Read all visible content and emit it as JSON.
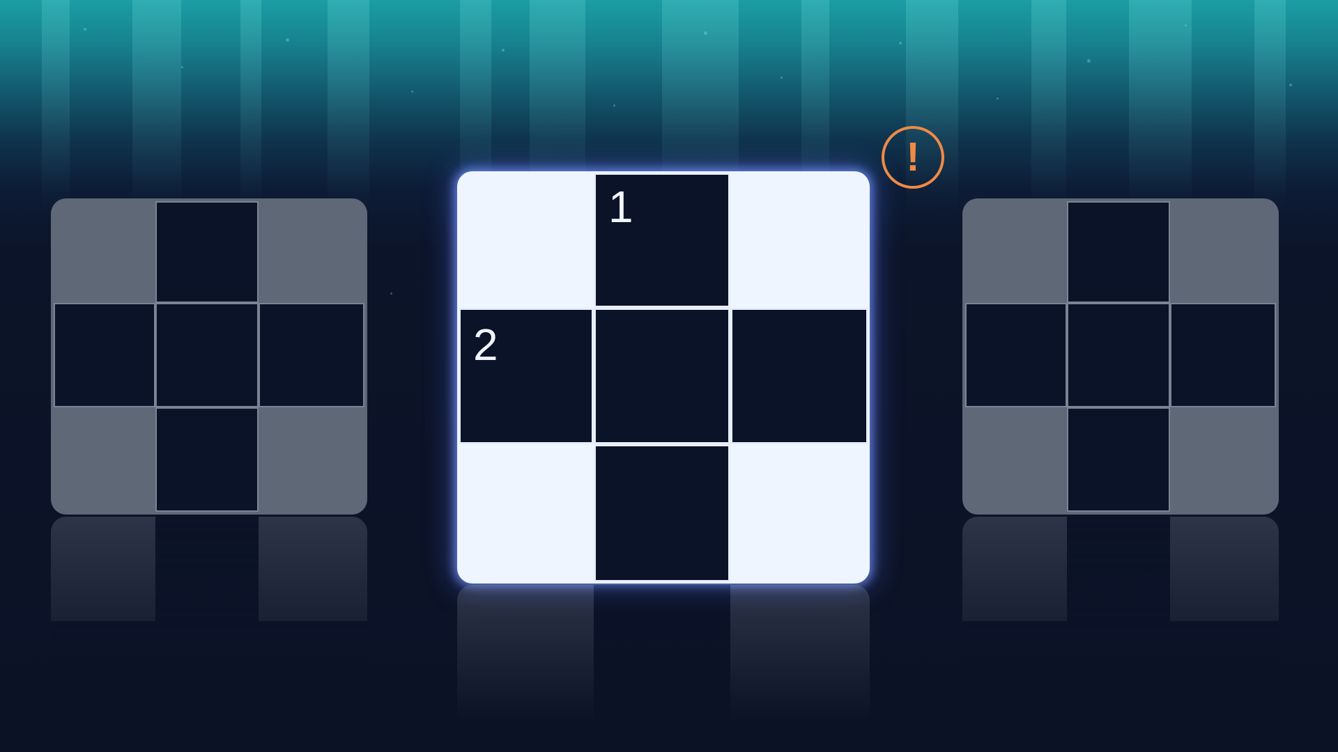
{
  "puzzle": {
    "clue_numbers": {
      "first": "1",
      "second": "2"
    }
  },
  "alert": {
    "icon": "exclamation-icon",
    "symbol": "!",
    "color": "#f08a45"
  },
  "colors": {
    "background_top": "#1b9ea3",
    "background_bottom": "#0c1226",
    "active_card": "#eef5ff",
    "inactive_card": "#5f6877",
    "cell_fill": "#0b1328",
    "active_glow": "#7896ff"
  }
}
